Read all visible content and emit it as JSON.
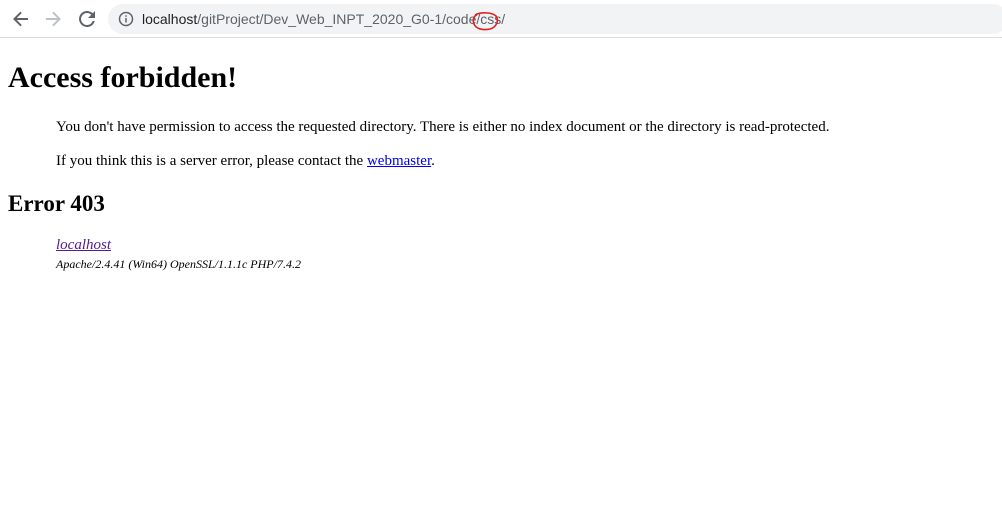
{
  "browser": {
    "url_host": "localhost",
    "url_path_prefix": "/gitProject/Dev_Web_INPT_2020_G0-1/code/",
    "url_path_highlight": "css",
    "url_path_suffix": "/",
    "icons": {
      "back": "back-arrow-icon",
      "forward": "forward-arrow-icon",
      "reload": "reload-icon",
      "info": "info-icon"
    },
    "annotation_color": "#e02020"
  },
  "page": {
    "title": "Access forbidden!",
    "message_1": "You don't have permission to access the requested directory. There is either no index document or the directory is read-protected.",
    "message_2_prefix": "If you think this is a server error, please contact the ",
    "message_2_link": "webmaster",
    "message_2_suffix": ".",
    "error_heading": "Error 403",
    "footer_link": "localhost",
    "server_signature": "Apache/2.4.41 (Win64) OpenSSL/1.1.1c PHP/7.4.2"
  }
}
